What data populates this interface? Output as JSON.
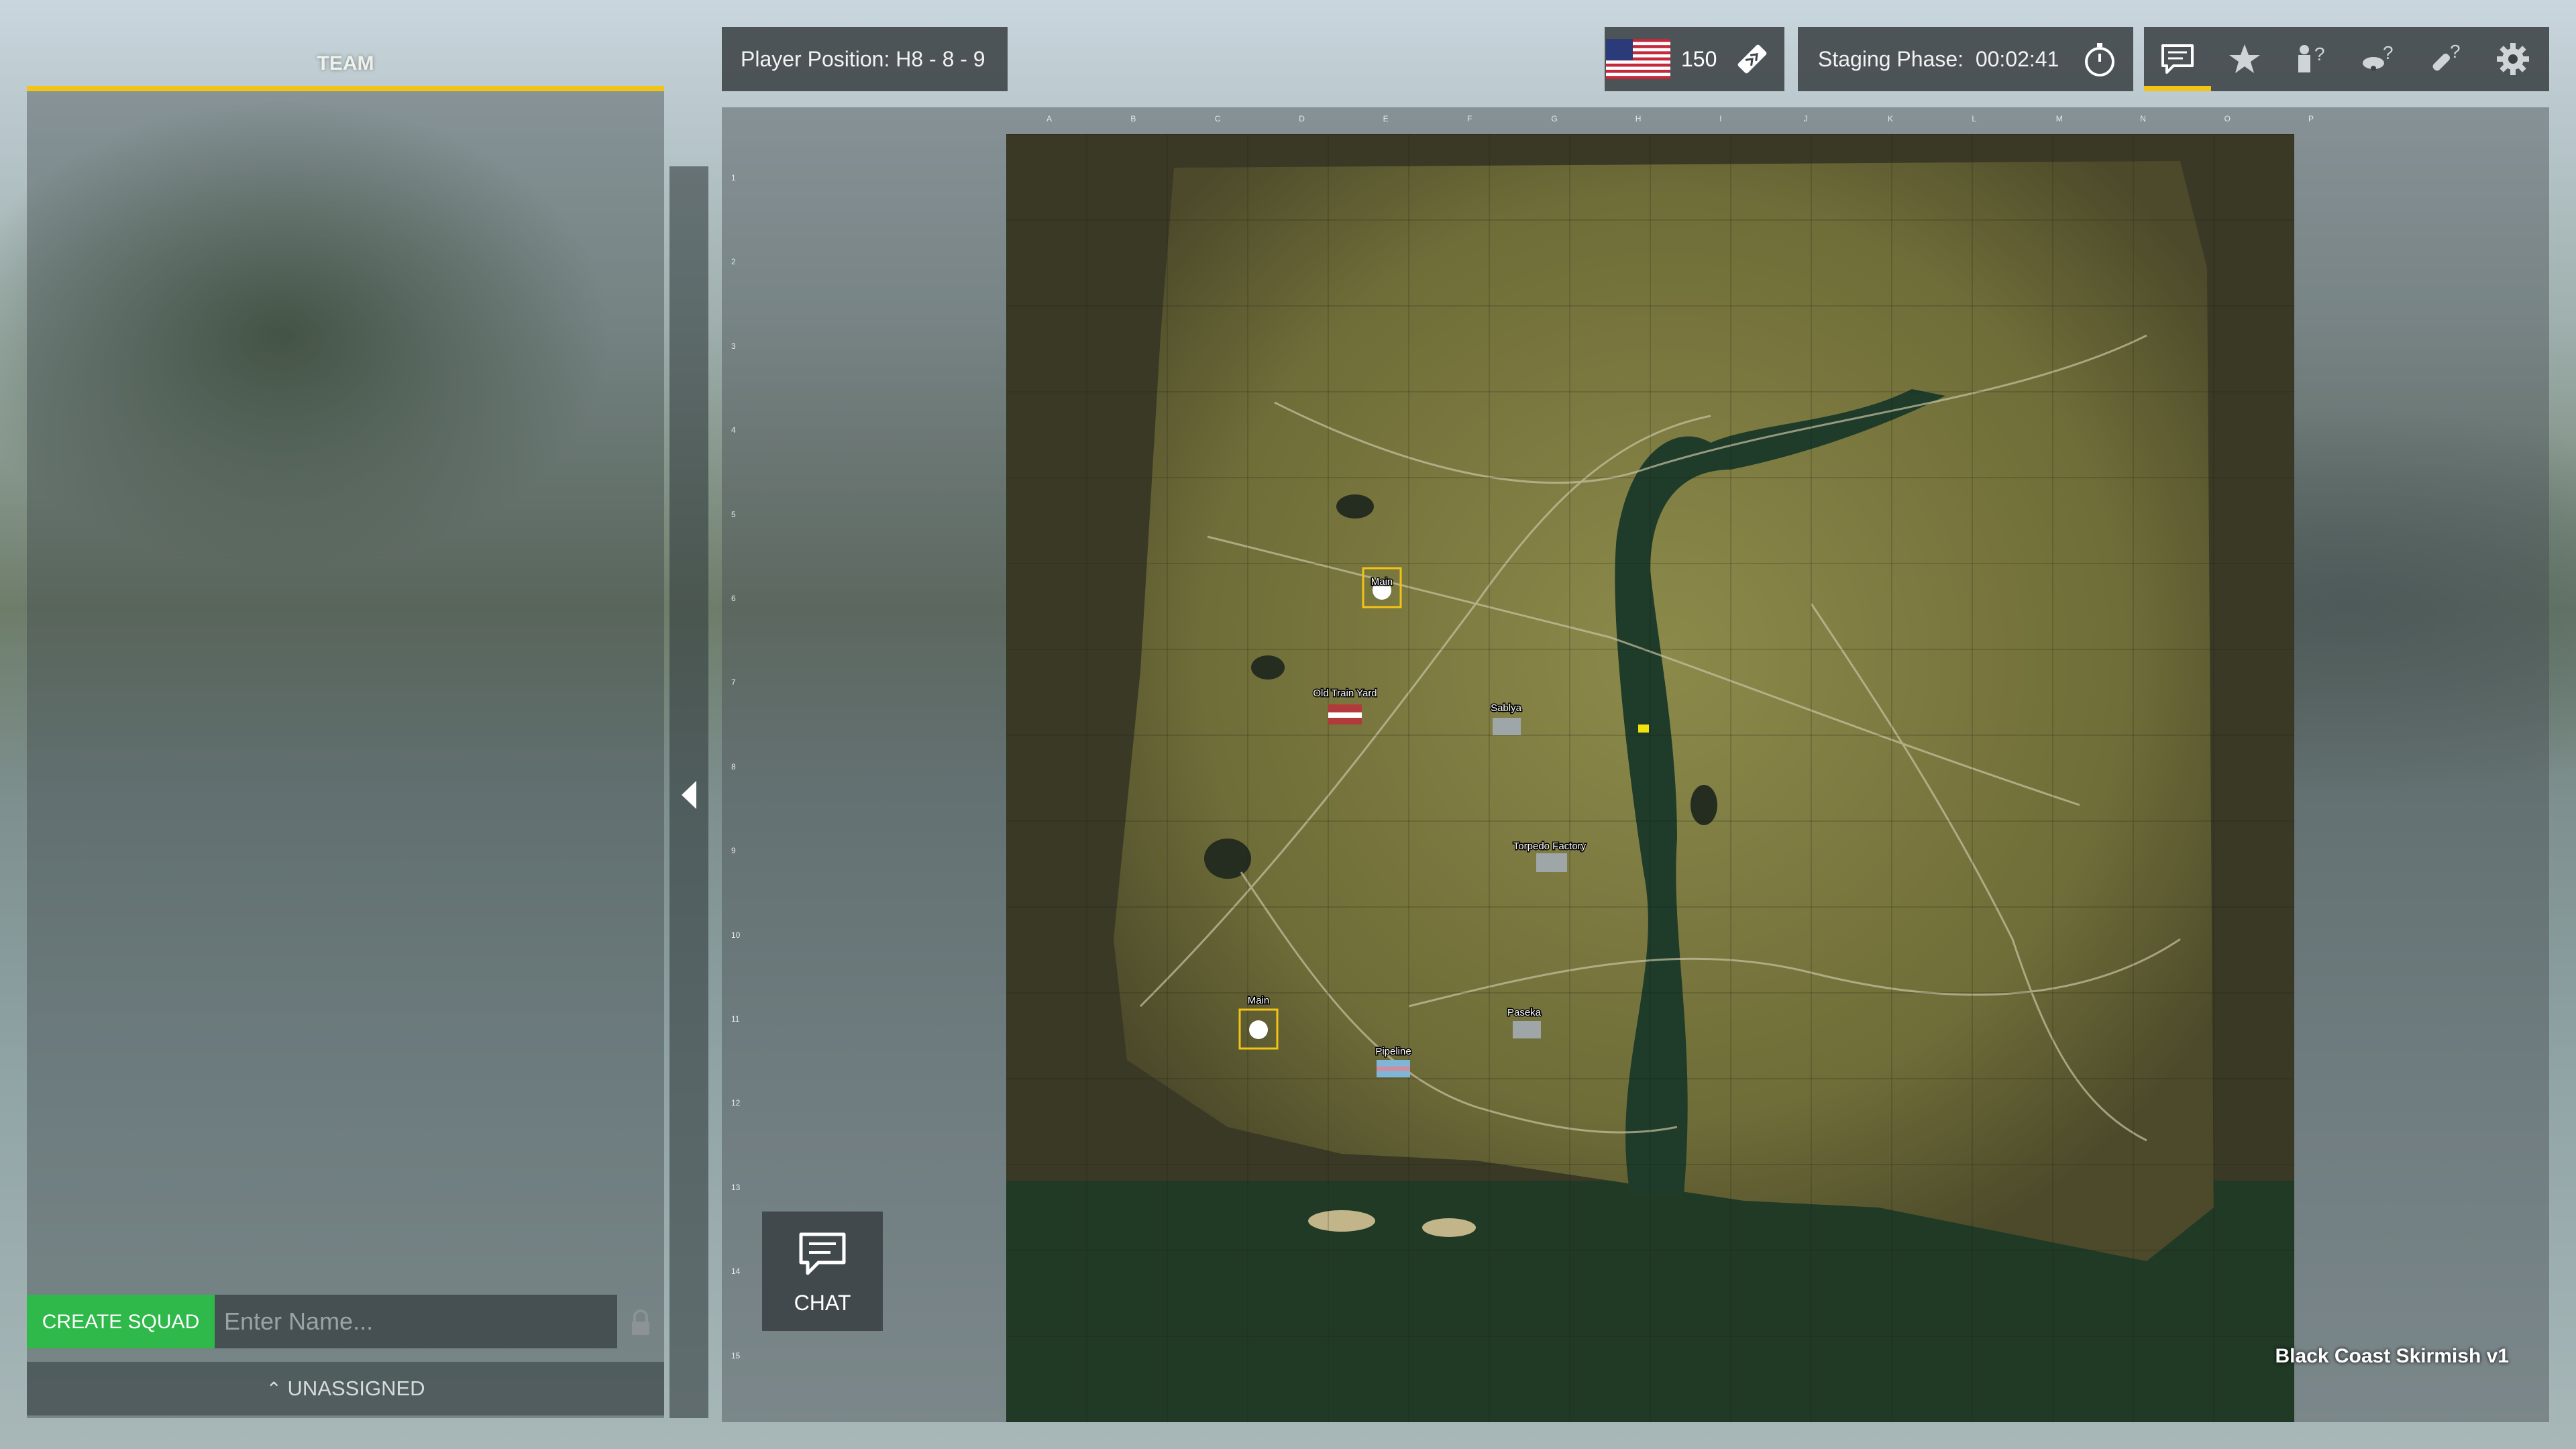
{
  "team_panel": {
    "tab_label": "TEAM",
    "create_squad_label": "CREATE SQUAD",
    "squad_name_placeholder": "Enter Name...",
    "unassigned_label": "UNASSIGNED",
    "accent_color": "#f2c418",
    "create_button_color": "#2fb94a"
  },
  "top_bar": {
    "player_position": "Player Position: H8 - 8 - 9",
    "team_flag": "us-flag",
    "tickets": "150",
    "staging_label": "Staging Phase:",
    "staging_time": "00:02:41",
    "menu_icons": [
      "chat-icon",
      "star-icon",
      "squad-help-icon",
      "vehicle-help-icon",
      "rocket-help-icon",
      "gear-icon"
    ],
    "active_menu": "chat-icon"
  },
  "map": {
    "name": "Black Coast Skirmish v1",
    "columns": [
      "A",
      "B",
      "C",
      "D",
      "E",
      "F",
      "G",
      "H",
      "I",
      "J",
      "K",
      "L",
      "M",
      "N",
      "O",
      "P"
    ],
    "rows": [
      "1",
      "2",
      "3",
      "4",
      "5",
      "6",
      "7",
      "8",
      "9",
      "10",
      "11",
      "12",
      "13",
      "14",
      "15"
    ],
    "locations": [
      {
        "name": "Main"
      },
      {
        "name": "Old Train Yard"
      },
      {
        "name": "Sablya"
      },
      {
        "name": "Torpedo Factory"
      },
      {
        "name": "Paseka"
      },
      {
        "name": "Pipeline"
      },
      {
        "name": "Main"
      }
    ]
  },
  "chat_button": {
    "label": "CHAT"
  }
}
